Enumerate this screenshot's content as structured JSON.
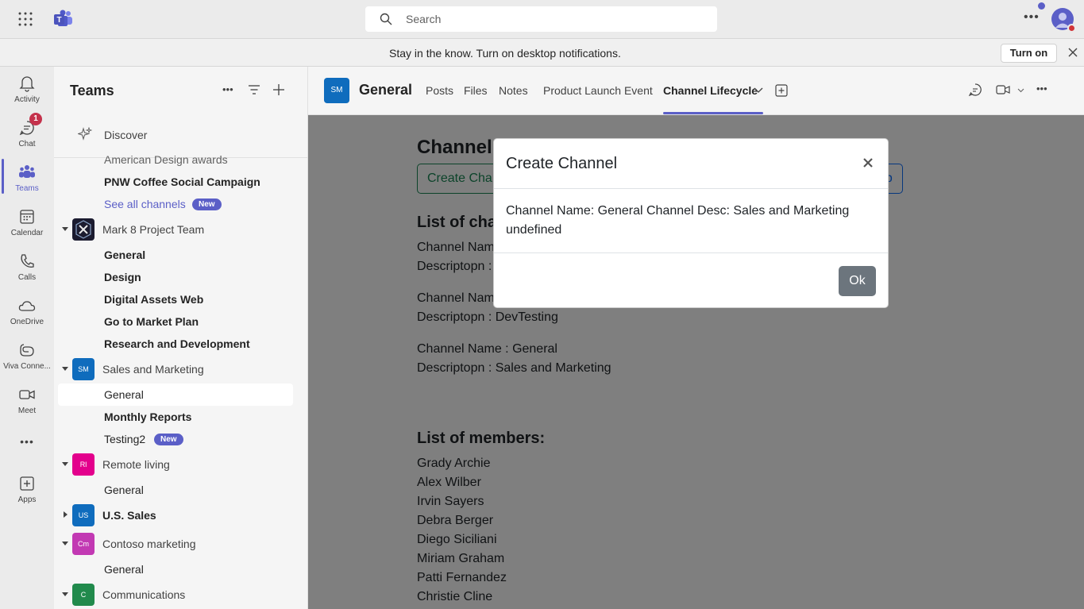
{
  "topbar": {
    "search_placeholder": "Search"
  },
  "notification": {
    "message": "Stay in the know. Turn on desktop notifications.",
    "turn_on_label": "Turn on"
  },
  "rail": {
    "items": [
      {
        "label": "Activity",
        "icon": "bell-icon"
      },
      {
        "label": "Chat",
        "icon": "chat-icon",
        "badge": "1"
      },
      {
        "label": "Teams",
        "icon": "teams-icon"
      },
      {
        "label": "Calendar",
        "icon": "calendar-icon"
      },
      {
        "label": "Calls",
        "icon": "phone-icon"
      },
      {
        "label": "OneDrive",
        "icon": "cloud-icon"
      },
      {
        "label": "Viva Conne...",
        "icon": "viva-icon"
      },
      {
        "label": "Meet",
        "icon": "video-icon"
      },
      {
        "label": "Apps",
        "icon": "add-app-icon"
      }
    ]
  },
  "teams_pane": {
    "title": "Teams",
    "discover_label": "Discover",
    "cut_channel": "American Design awards",
    "channel_pnw": "PNW Coffee Social Campaign",
    "see_all_channels": "See all channels",
    "new_label": "New",
    "teams": [
      {
        "name": "Mark 8 Project Team",
        "channels": [
          "General",
          "Design",
          "Digital Assets Web",
          "Go to Market Plan",
          "Research and Development"
        ]
      },
      {
        "name": "Sales and Marketing",
        "initials": "SM",
        "channels": [
          "General",
          "Monthly Reports",
          "Testing2"
        ]
      },
      {
        "name": "Remote living",
        "initials": "Rl",
        "channels": [
          "General"
        ]
      },
      {
        "name": "U.S. Sales",
        "initials": "US",
        "channels": []
      },
      {
        "name": "Contoso marketing",
        "initials": "Cm",
        "channels": [
          "General"
        ]
      },
      {
        "name": "Communications",
        "initials": "C",
        "channels": []
      }
    ]
  },
  "header": {
    "channel_initials": "SM",
    "channel_name": "General",
    "tabs": [
      "Posts",
      "Files",
      "Notes",
      "Product Launch Event",
      "Channel Lifecycle"
    ]
  },
  "content": {
    "title": "Channel",
    "create_button": "Create Chan",
    "tab_button": "Tab",
    "list_channels_heading": "List of char",
    "channels": [
      {
        "name_line": "Channel Nam",
        "desc_line": "Descriptopn :"
      },
      {
        "name_line": "Channel Nam",
        "desc_line": "Descriptopn : DevTesting"
      },
      {
        "name_line": "Channel Name : General",
        "desc_line": "Descriptopn : Sales and Marketing"
      }
    ],
    "members_heading": "List of members:",
    "members": [
      "Grady Archie",
      "Alex Wilber",
      "Irvin Sayers",
      "Debra Berger",
      "Diego Siciliani",
      "Miriam Graham",
      "Patti Fernandez",
      "Christie Cline"
    ]
  },
  "modal": {
    "title": "Create Channel",
    "body": "Channel Name: General Channel Desc: Sales and Marketing undefined",
    "ok_label": "Ok"
  },
  "colors": {
    "accent": "#5b5fc7",
    "success": "#198754",
    "primary": "#0d6efd",
    "secondary": "#6c757d",
    "badge": "#c4314b"
  }
}
